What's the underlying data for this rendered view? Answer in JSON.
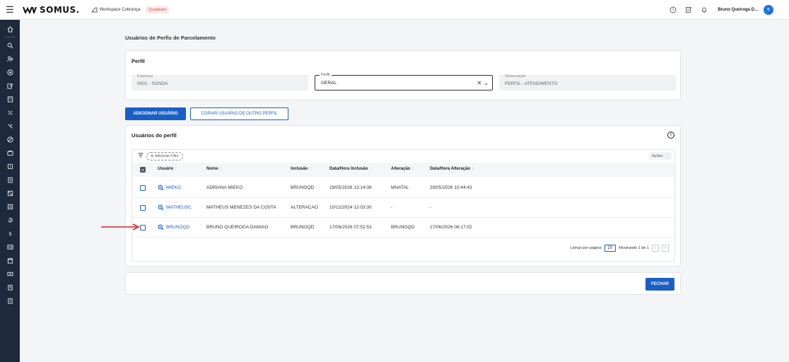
{
  "topbar": {
    "brand": "SOMUS.",
    "workspace": "Workspace Cobrança",
    "environment": "Qualidade",
    "user_name": "Bruno Queiroga D...",
    "avatar_initials": "B",
    "accent_color": "#1a5fc8"
  },
  "page": {
    "title": "Usuários de Perfis de Parcelamento"
  },
  "perfil": {
    "title": "Perfil",
    "empresa": {
      "label": "Empresa",
      "value": "0001 - SONDA"
    },
    "perfil": {
      "label": "Perfil",
      "value": "GERAL"
    },
    "observacao": {
      "label": "Observação",
      "value": "PERFIL - ATENDIMENTO"
    }
  },
  "buttons": {
    "add_user": "ADICIONAR USUÁRIO",
    "copy_user": "COPIAR USUÁRIO DE OUTRO PERFIL",
    "close": "FECHAR"
  },
  "users": {
    "title": "Usuários do perfil",
    "add_filter": "Adicionar Filtro",
    "actions": "Ações",
    "columns": {
      "usuario": "Usuário",
      "nome": "Nome",
      "inclusao": "Inclusão",
      "data_inclusao": "Data/Hora Inclusão",
      "alteracao": "Alteração",
      "data_alteracao": "Data/Hora Alteração"
    },
    "rows": [
      {
        "usuario": "MIEKO",
        "nome": "ADRIANA MIEKO",
        "inclusao": "BRUNOQD",
        "data_inclusao": "19/05/2026 13:14:08",
        "alteracao": "MNATAL",
        "data_alteracao": "29/05/2026 10:44:43"
      },
      {
        "usuario": "MATHEUSC",
        "nome": "MATHEUS MENEZES DA COSTA",
        "inclusao": "ALTERACAO",
        "data_inclusao": "10/12/2024 12:03:30",
        "alteracao": "-",
        "data_alteracao": "-"
      },
      {
        "usuario": "BRUNOQD",
        "nome": "BRUNO QUEIROGA DAMIAO",
        "inclusao": "BRUNOQD",
        "data_inclusao": "17/06/2026 07:52:53",
        "alteracao": "BRUNOQD",
        "data_alteracao": "17/06/2026 08:17:02"
      }
    ],
    "pager": {
      "rows_per_page_label": "Linhas por página",
      "rows_per_page": "20",
      "showing": "Mostrando 1 de 1"
    }
  }
}
